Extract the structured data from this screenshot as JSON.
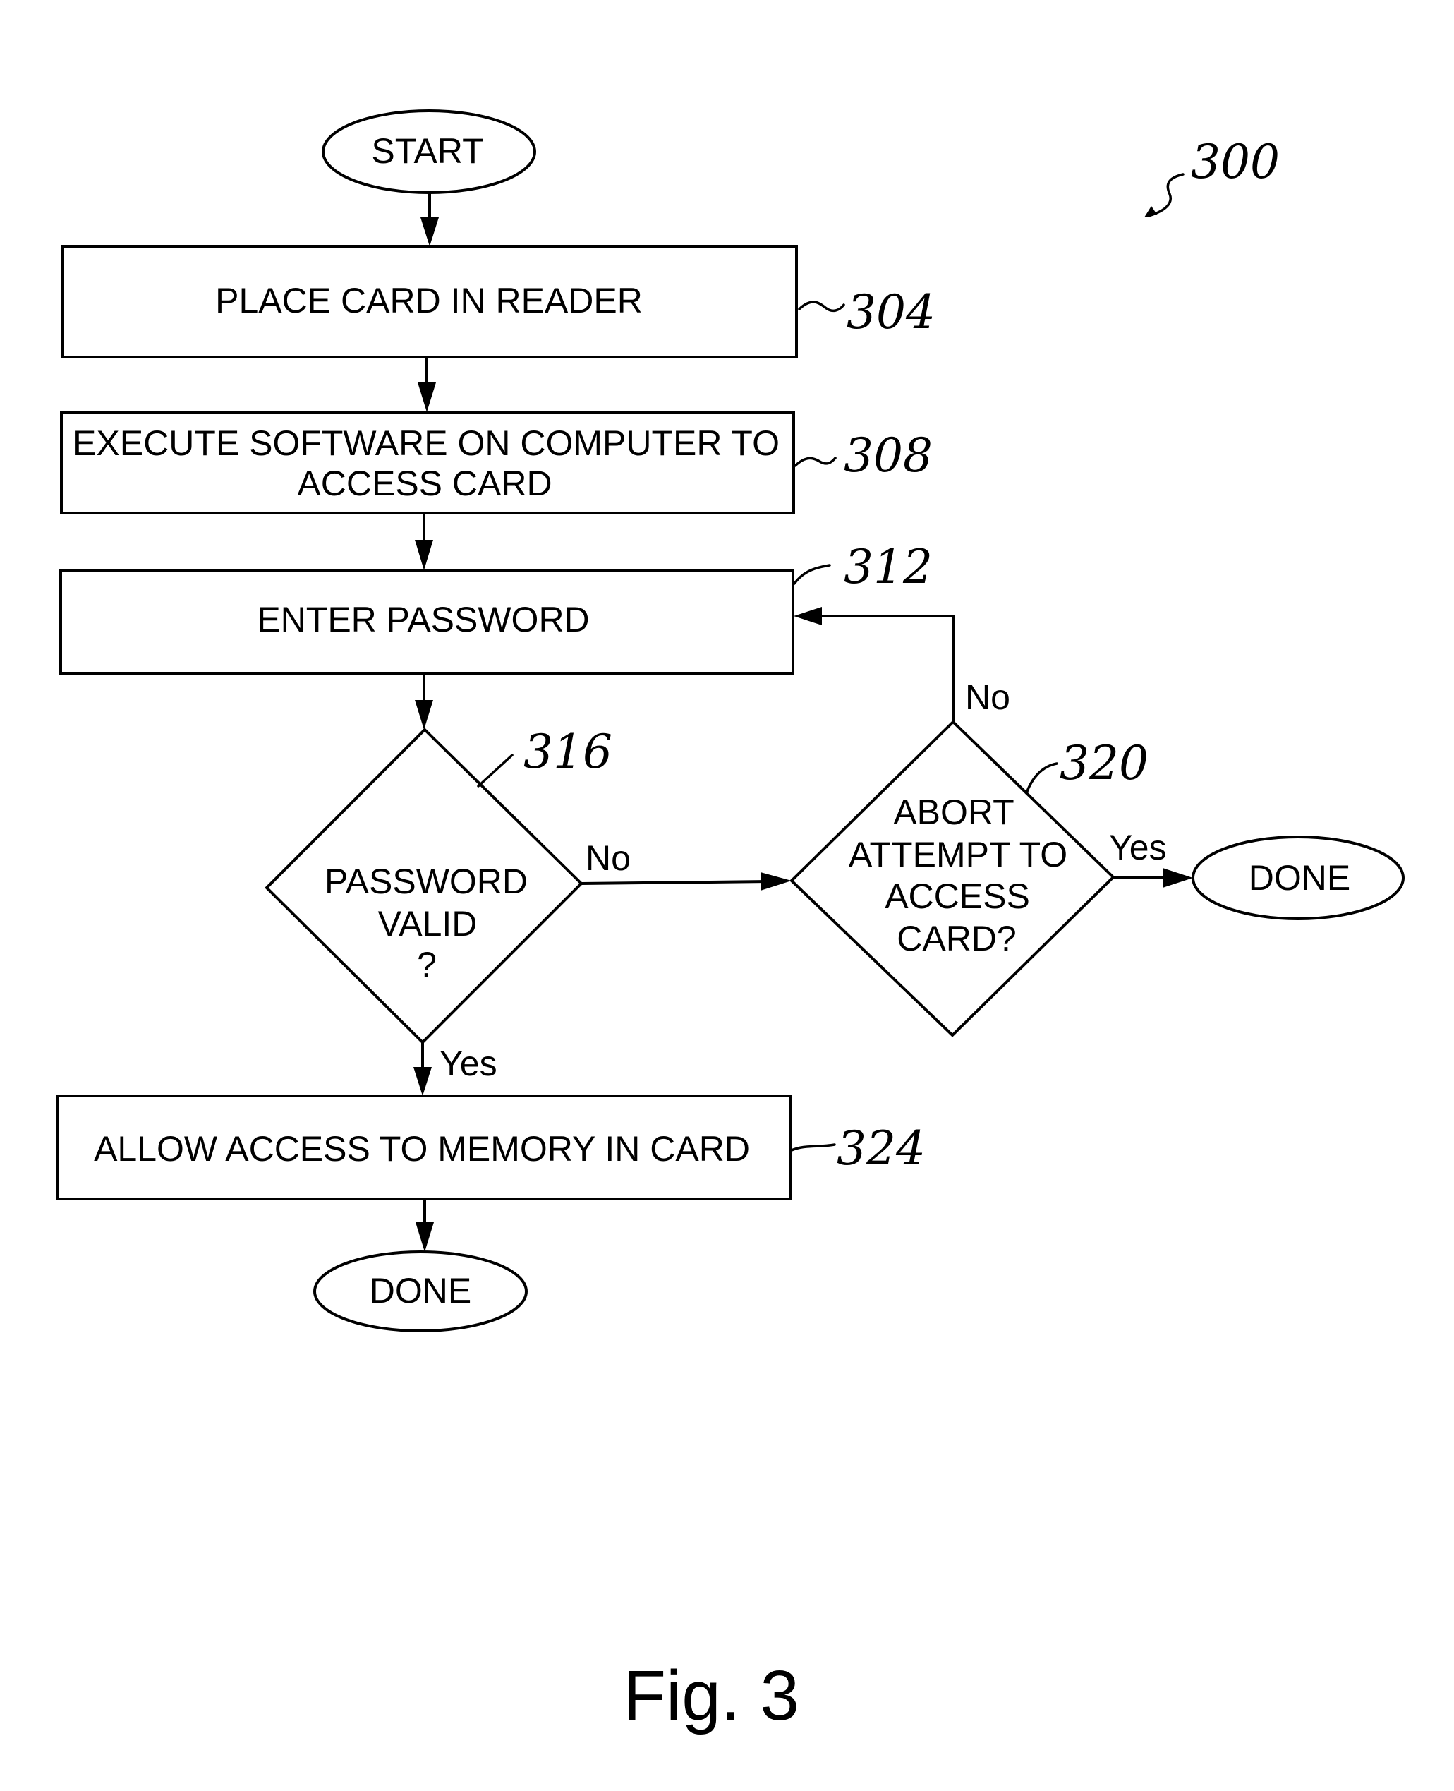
{
  "figure": {
    "reference_number": "300",
    "caption": "Fig. 3"
  },
  "nodes": {
    "start": {
      "type": "terminal",
      "label": "START"
    },
    "step_304": {
      "type": "process",
      "ref": "304",
      "lines": [
        "PLACE CARD IN READER"
      ]
    },
    "step_308": {
      "type": "process",
      "ref": "308",
      "lines": [
        "EXECUTE SOFTWARE ON COMPUTER TO",
        "ACCESS CARD"
      ]
    },
    "step_312": {
      "type": "process",
      "ref": "312",
      "lines": [
        "ENTER PASSWORD"
      ]
    },
    "decision_316": {
      "type": "decision",
      "ref": "316",
      "lines": [
        "PASSWORD",
        "VALID",
        "?"
      ]
    },
    "decision_320": {
      "type": "decision",
      "ref": "320",
      "lines": [
        "ABORT",
        "ATTEMPT TO",
        "ACCESS",
        "CARD?"
      ]
    },
    "step_324": {
      "type": "process",
      "ref": "324",
      "lines": [
        "ALLOW ACCESS TO MEMORY IN CARD"
      ]
    },
    "done_abort": {
      "type": "terminal",
      "label": "DONE"
    },
    "done_access": {
      "type": "terminal",
      "label": "DONE"
    }
  },
  "edges": {
    "316_to_320": {
      "label": "No"
    },
    "316_to_324": {
      "label": "Yes"
    },
    "320_to_312": {
      "label": "No"
    },
    "320_to_done": {
      "label": "Yes"
    }
  }
}
